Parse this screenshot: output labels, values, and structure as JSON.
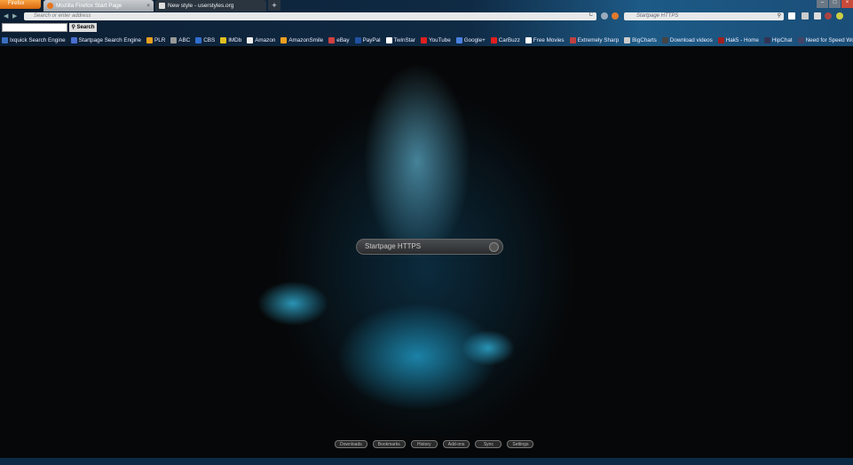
{
  "browser": {
    "menu_label": "Firefox",
    "new_tab_label": "+"
  },
  "tabs": [
    {
      "title": "Mozilla Firefox Start Page",
      "close": "×"
    },
    {
      "title": "New style - userstyles.org"
    }
  ],
  "nav": {
    "back": "◀",
    "forward": "▶",
    "url_placeholder": "Search or enter address",
    "reload": "C",
    "search_engine_placeholder": "Startpage HTTPS",
    "search_icon": "⚲"
  },
  "window": {
    "minimize": "–",
    "maximize": "□",
    "close": "×"
  },
  "toolbar_search": {
    "button": "Search"
  },
  "bookmarks": [
    "Ixquick Search Engine",
    "Startpage Search Engine",
    "PLR",
    "ABC",
    "CBS",
    "IMDb",
    "Amazon",
    "AmazonSmile",
    "eBay",
    "PayPal",
    "TwinStar",
    "YouTube",
    "Google+",
    "CarBuzz",
    "Free Movies",
    "Extremely Sharp",
    "BigCharts",
    "Download videos",
    "Hak5 - Home",
    "HipChat",
    "Need for Speed World"
  ],
  "bookmark_colors": [
    "#3a6fc0",
    "#4a6fd0",
    "#e8a020",
    "#999",
    "#3070d0",
    "#e0c020",
    "#eee",
    "#f0a020",
    "#d04040",
    "#2050a0",
    "#fff",
    "#e02020",
    "#4a80e0",
    "#e02020",
    "#fff",
    "#c04040",
    "#ccc",
    "#444",
    "#a02020",
    "#335",
    "#446"
  ],
  "page": {
    "search_placeholder": "Startpage HTTPS",
    "buttons": [
      "Downloads",
      "Bookmarks",
      "History",
      "Add-ons",
      "Sync",
      "Settings"
    ]
  }
}
